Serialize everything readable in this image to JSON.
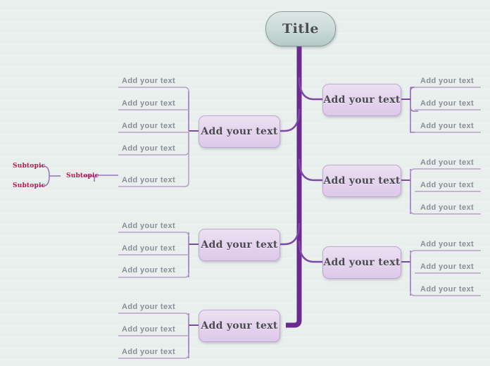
{
  "canvas": {
    "background_color": "#e8efed",
    "rule_line_color": "#eef3f2"
  },
  "colors": {
    "trunk": "#6b2a91",
    "branch": "#7d48a6",
    "leaf_underline": "#b9a0cf",
    "node_fill": "#e4d4ee",
    "node_border": "#bfa9cf",
    "title_fill": "#cdddda",
    "leaf_text": "#8d8d98",
    "subtopic_text": "#c81050"
  },
  "root": {
    "label": "Title"
  },
  "branches": {
    "left": [
      {
        "name": "left-branch-1",
        "topic": "Add your text",
        "leaves": [
          "Add your text",
          "Add your text",
          "Add your text",
          "Add your text",
          "Add your text"
        ]
      },
      {
        "name": "left-branch-2",
        "topic": "Add your text",
        "leaves": [
          "Add your text",
          "Add your text",
          "Add your text"
        ]
      },
      {
        "name": "left-branch-3",
        "topic": "Add your text",
        "leaves": [
          "Add your text",
          "Add your text",
          "Add your text"
        ]
      }
    ],
    "right": [
      {
        "name": "right-branch-1",
        "topic": "Add your text",
        "leaves": [
          "Add your text",
          "Add your text",
          "Add your text"
        ]
      },
      {
        "name": "right-branch-2",
        "topic": "Add your text",
        "leaves": [
          "Add your text",
          "Add your text",
          "Add your text"
        ]
      },
      {
        "name": "right-branch-3",
        "topic": "Add your text",
        "leaves": [
          "Add your text",
          "Add your text",
          "Add your text"
        ]
      }
    ]
  },
  "subtopics": {
    "middle": "Subtopic",
    "upper": "Subtopic",
    "lower": "Subtopic"
  }
}
